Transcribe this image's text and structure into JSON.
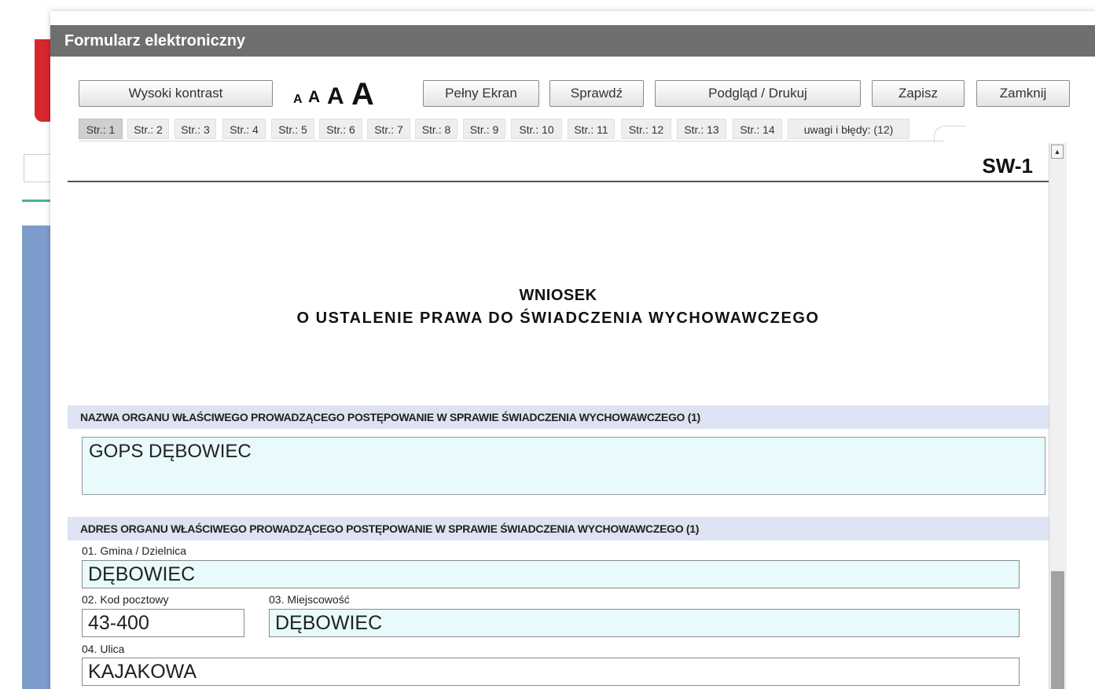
{
  "modal": {
    "title": "Formularz elektroniczny"
  },
  "toolbar": {
    "high_contrast": "Wysoki kontrast",
    "font_sizes": [
      "A",
      "A",
      "A",
      "A"
    ],
    "fullscreen": "Pełny Ekran",
    "check": "Sprawdź",
    "preview": "Podgląd / Drukuj",
    "save": "Zapisz",
    "close": "Zamknij"
  },
  "tabs": [
    "Str.: 1",
    "Str.: 2",
    "Str.: 3",
    "Str.: 4",
    "Str.: 5",
    "Str.: 6",
    "Str.: 7",
    "Str.: 8",
    "Str.: 9",
    "Str.: 10",
    "Str.: 11",
    "Str.: 12",
    "Str.: 13",
    "Str.: 14",
    "uwagi i błędy: (12)"
  ],
  "active_tab": "Str.: 1",
  "document": {
    "code": "SW-1",
    "title_line1": "WNIOSEK",
    "title_line2": "O USTALENIE PRAWA DO ŚWIADCZENIA WYCHOWAWCZEGO",
    "section1": {
      "heading": "NAZWA ORGANU WŁAŚCIWEGO PROWADZĄCEGO POSTĘPOWANIE W SPRAWIE ŚWIADCZENIA WYCHOWAWCZEGO (1)",
      "value": "GOPS DĘBOWIEC"
    },
    "section2": {
      "heading": "ADRES ORGANU WŁAŚCIWEGO PROWADZĄCEGO POSTĘPOWANIE W SPRAWIE ŚWIADCZENIA WYCHOWAWCZEGO (1)",
      "gmina_label": "01. Gmina / Dzielnica",
      "gmina_value": "DĘBOWIEC",
      "postal_label": "02. Kod pocztowy",
      "postal_value": "43-400",
      "city_label": "03. Miejscowość",
      "city_value": "DĘBOWIEC",
      "street_label": "04. Ulica",
      "street_value": "KAJAKOWA"
    }
  },
  "colors": {
    "titlebar": "#6f6f6f",
    "section_header": "#dde3f3",
    "field_fill": "#e8fafb"
  }
}
